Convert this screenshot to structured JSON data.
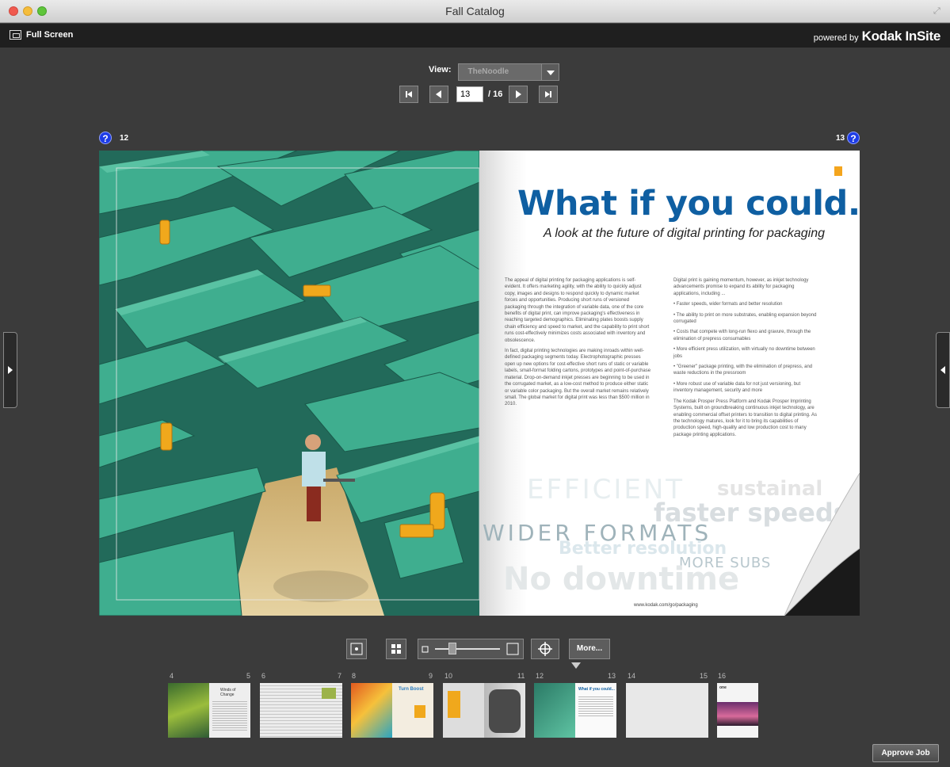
{
  "window": {
    "title": "Fall Catalog"
  },
  "toolbar": {
    "full_screen_label": "Full Screen",
    "powered_by": "powered by",
    "brand": "Kodak InSite"
  },
  "view": {
    "label": "View:",
    "selected": "TheNoodle"
  },
  "navigation": {
    "current_page": "13",
    "total": "/ 16"
  },
  "spread": {
    "left_page_number": "12",
    "right_page_number": "13",
    "help_label": "?",
    "headline": "What if you could...",
    "subhead": "A look at the future of digital printing for packaging",
    "col1_p1": "The appeal of digital printing for packaging applications is self-evident. It offers marketing agility, with the ability to quickly adjust copy, images and designs to respond quickly to dynamic market forces and opportunities. Producing short runs of versioned packaging through the integration of variable data, one of the core benefits of digital print, can improve packaging's effectiveness in reaching targeted demographics. Eliminating plates boosts supply chain efficiency and speed to market, and the capability to print short runs cost-effectively minimizes costs associated with inventory and obsolescence.",
    "col1_p2": "In fact, digital printing technologies are making inroads within well-defined packaging segments today. Electrophotographic presses open up new options for cost-effective short runs of static or variable labels, small-format folding cartons, prototypes and point-of-purchase material. Drop-on-demand inkjet presses are beginning to be used in the corrugated market, as a low-cost method to produce either static or variable color packaging. But the overall market remains relatively small. The global market for digital print was less than $500 million in 2010.",
    "col2_intro": "Digital print is gaining momentum, however, as inkjet technology advancements promise to expand its ability for packaging applications, including ...",
    "col2_bullets": [
      "• Faster speeds, wider formats and better resolution",
      "• The ability to print on more substrates, enabling expansion beyond corrugated",
      "• Costs that compete with long-run flexo and gravure, through the elimination of prepress consumables",
      "• More efficient press utilization, with virtually no downtime between jobs",
      "• \"Greener\" package printing, with the elimination of prepress, and waste reductions in the pressroom",
      "• More robust use of variable data for not just versioning, but inventory management, security and more"
    ],
    "col2_outro": "The Kodak Prosper Press Platform and Kodak Prosper Imprinting Systems, built on groundbreaking continuous inkjet technology, are enabling commercial offset printers to transition to digital printing. As the technology matures, look for it to bring its capabilities of production speed, high-quality and low production cost to many package printing applications.",
    "wordcloud": {
      "efficient": "EFFICIENT",
      "sustainable": "sustainal",
      "faster": "faster speeds",
      "wider": "WIDER FORMATS",
      "better": "Better resolution",
      "more_subs": "MORE SUBS",
      "downtime": "No downtime"
    },
    "url": "www.kodak.com/go/packaging"
  },
  "bottom_toolbar": {
    "more_label": "More..."
  },
  "thumbnails": {
    "labels": [
      "4",
      "5",
      "6",
      "7",
      "8",
      "9",
      "10",
      "11",
      "12",
      "13",
      "14",
      "15",
      "16"
    ],
    "t5_title": "Winds of Change",
    "t9_title": "Turn Boost",
    "t13_title": "What if you could...",
    "t16_title": "one"
  },
  "footer": {
    "approve_label": "Approve Job"
  },
  "colors": {
    "headline": "#0f5fa2",
    "maze": "#2f9f86",
    "accent": "#f4a51d"
  }
}
